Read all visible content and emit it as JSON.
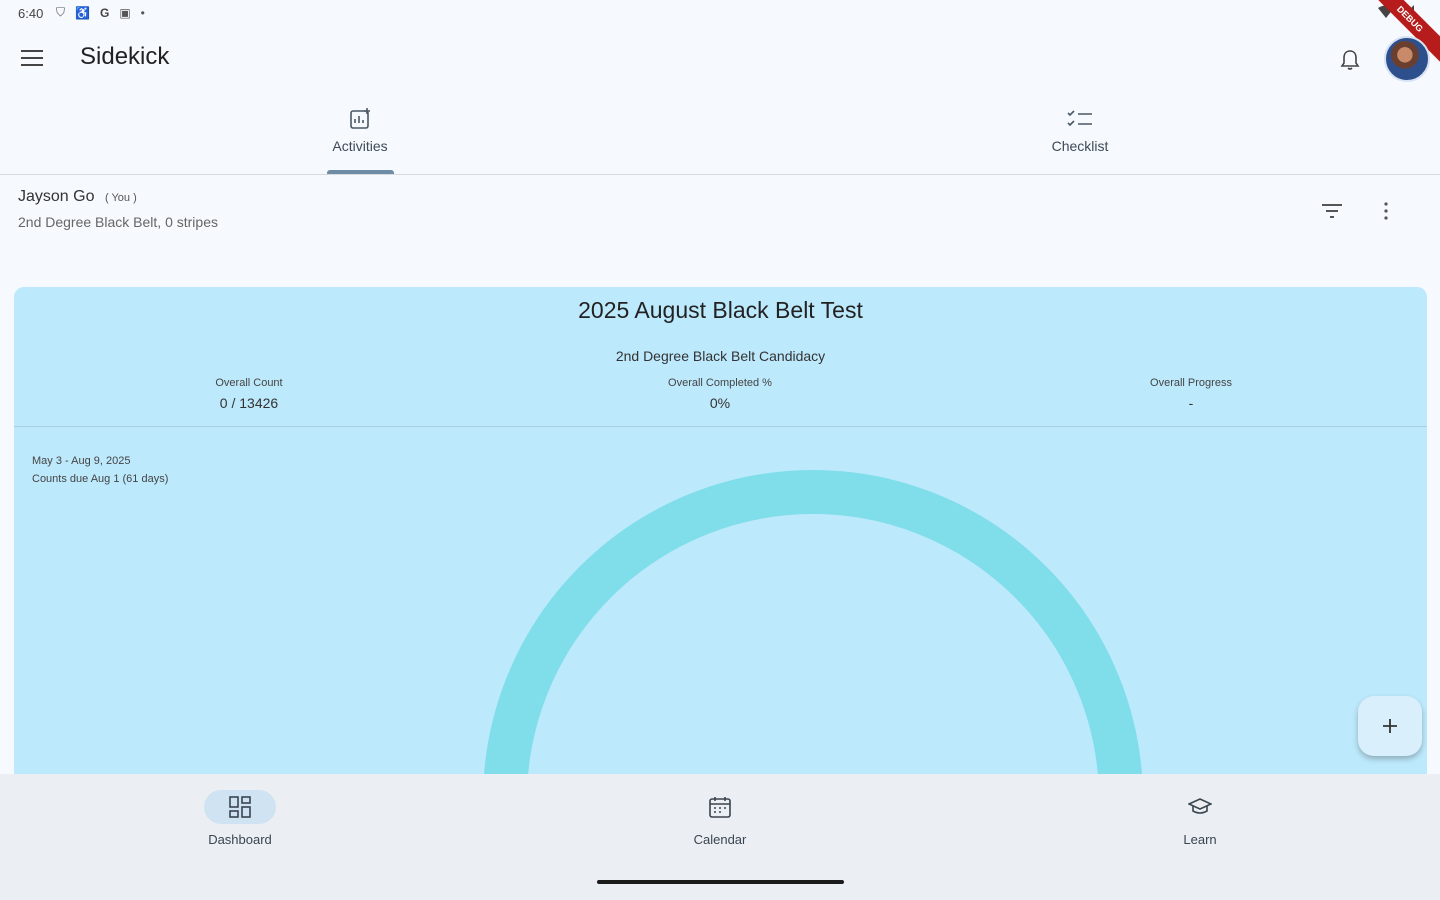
{
  "status_bar": {
    "time": "6:40",
    "icons": [
      "shield-icon",
      "accessibility-icon",
      "google-icon",
      "screen-icon",
      "dot-icon"
    ]
  },
  "app_bar": {
    "title": "Sidekick"
  },
  "tabs": [
    {
      "label": "Activities",
      "icon": "activities-icon",
      "active": true
    },
    {
      "label": "Checklist",
      "icon": "checklist-icon",
      "active": false
    }
  ],
  "member": {
    "name": "Jayson Go",
    "you_tag": "( You )",
    "rank": "2nd Degree Black Belt, 0 stripes"
  },
  "card": {
    "title": "2025 August Black Belt Test",
    "subtitle": "2nd Degree Black Belt Candidacy",
    "stats": [
      {
        "label": "Overall Count",
        "value": "0 / 13426"
      },
      {
        "label": "Overall Completed %",
        "value": "0%"
      },
      {
        "label": "Overall Progress",
        "value": "-"
      }
    ],
    "date_range": "May 3 - Aug 9, 2025",
    "counts_due": "Counts due Aug 1 (61 days)",
    "gauge_progress": 0,
    "gauge_color": "#80deea"
  },
  "fab": {
    "icon": "plus-icon"
  },
  "bottom_nav": [
    {
      "label": "Dashboard",
      "icon": "dashboard-icon",
      "active": true
    },
    {
      "label": "Calendar",
      "icon": "calendar-icon",
      "active": false
    },
    {
      "label": "Learn",
      "icon": "school-icon",
      "active": false
    }
  ],
  "debug_banner": "DEBUG"
}
